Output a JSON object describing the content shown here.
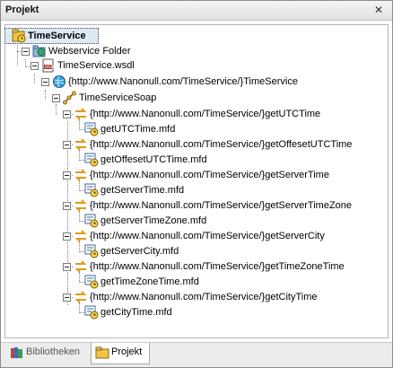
{
  "panel": {
    "title": "Projekt",
    "close_glyph": "✕"
  },
  "tree": {
    "root": {
      "label": "TimeService",
      "icon": "project-icon"
    },
    "folder": {
      "label": "Webservice Folder",
      "icon": "webservice-folder-icon"
    },
    "wsdl": {
      "label": "TimeService.wsdl",
      "icon": "wsdl-file-icon"
    },
    "service": {
      "label": "{http://www.Nanonull.com/TimeService/}TimeService",
      "icon": "globe-icon"
    },
    "soap": {
      "label": "TimeServiceSoap",
      "icon": "soap-port-icon"
    },
    "operations": [
      {
        "label": "{http://www.Nanonull.com/TimeService/}getUTCTime",
        "mapping": "getUTCTime.mfd"
      },
      {
        "label": "{http://www.Nanonull.com/TimeService/}getOffesetUTCTime",
        "mapping": "getOffesetUTCTime.mfd"
      },
      {
        "label": "{http://www.Nanonull.com/TimeService/}getServerTime",
        "mapping": "getServerTime.mfd"
      },
      {
        "label": "{http://www.Nanonull.com/TimeService/}getServerTimeZone",
        "mapping": "getServerTimeZone.mfd"
      },
      {
        "label": "{http://www.Nanonull.com/TimeService/}getServerCity",
        "mapping": "getServerCity.mfd"
      },
      {
        "label": "{http://www.Nanonull.com/TimeService/}getTimeZoneTime",
        "mapping": "getTimeZoneTime.mfd"
      },
      {
        "label": "{http://www.Nanonull.com/TimeService/}getCityTime",
        "mapping": "getCityTime.mfd"
      }
    ]
  },
  "tabs": [
    {
      "label": "Bibliotheken",
      "icon": "libraries-icon",
      "active": false
    },
    {
      "label": "Projekt",
      "icon": "project-folder-icon",
      "active": true
    }
  ]
}
